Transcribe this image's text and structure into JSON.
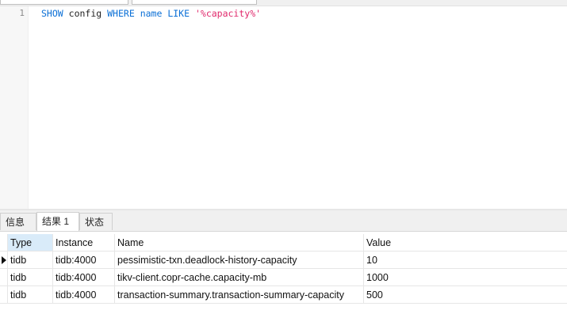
{
  "editor": {
    "line_number": "1",
    "tokens": {
      "show": "SHOW",
      "config": "config",
      "where": "WHERE",
      "name": "name",
      "like": "LIKE",
      "pattern": "'%capacity%'"
    }
  },
  "tabs": [
    {
      "label": "信息"
    },
    {
      "label": "结果 1"
    },
    {
      "label": "状态"
    }
  ],
  "grid": {
    "columns": [
      "Type",
      "Instance",
      "Name",
      "Value"
    ],
    "rows": [
      {
        "type": "tidb",
        "instance": "tidb:4000",
        "name": "pessimistic-txn.deadlock-history-capacity",
        "value": "10"
      },
      {
        "type": "tidb",
        "instance": "tidb:4000",
        "name": "tikv-client.copr-cache.capacity-mb",
        "value": "1000"
      },
      {
        "type": "tidb",
        "instance": "tidb:4000",
        "name": "transaction-summary.transaction-summary-capacity",
        "value": "500"
      }
    ]
  },
  "colors": {
    "keyword": "#0a6fd6",
    "string": "#e0286b",
    "header_selected": "#d9ebf9"
  }
}
